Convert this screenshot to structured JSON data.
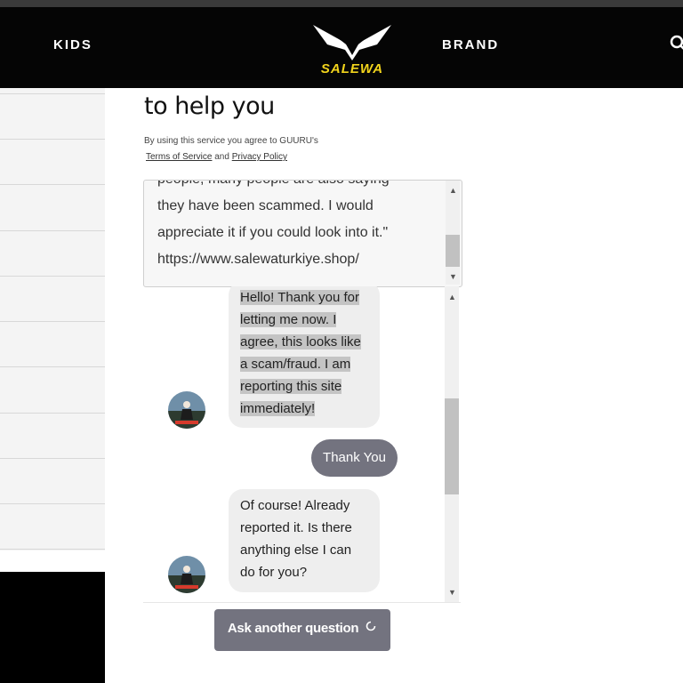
{
  "header": {
    "nav_left": "KIDS",
    "nav_right": "BRAND",
    "logo_text": "SALEWA",
    "search_icon": "search-icon",
    "logo_color": "#f2d41c"
  },
  "help": {
    "title": "to help you",
    "terms_prefix": "By using this service you agree to GUURU's",
    "terms_link": "Terms of Service",
    "and": "and",
    "privacy_link": "Privacy Policy"
  },
  "question": {
    "lines": [
      "people, many people are also saying",
      "they have been scammed. I would",
      "appreciate it if you could look into it.\"",
      "https://www.salewaturkiye.shop/"
    ]
  },
  "chat": {
    "messages": [
      {
        "from": "agent",
        "lines": [
          "Hello! Thank you for",
          "letting me now. I",
          "agree, this looks like",
          "a scam/fraud. I am",
          "reporting this site",
          "immediately!"
        ],
        "highlighted": true
      },
      {
        "from": "user",
        "text": "Thank You"
      },
      {
        "from": "agent",
        "lines": [
          "Of course! Already",
          "reported it. Is there",
          "anything else I can",
          "do for you?"
        ],
        "highlighted": false
      }
    ]
  },
  "ask_button": {
    "label": "Ask another question",
    "icon": "refresh-icon"
  },
  "colors": {
    "header_bg": "#050505",
    "user_bubble": "#73737f",
    "agent_bubble": "#eeeeee"
  }
}
